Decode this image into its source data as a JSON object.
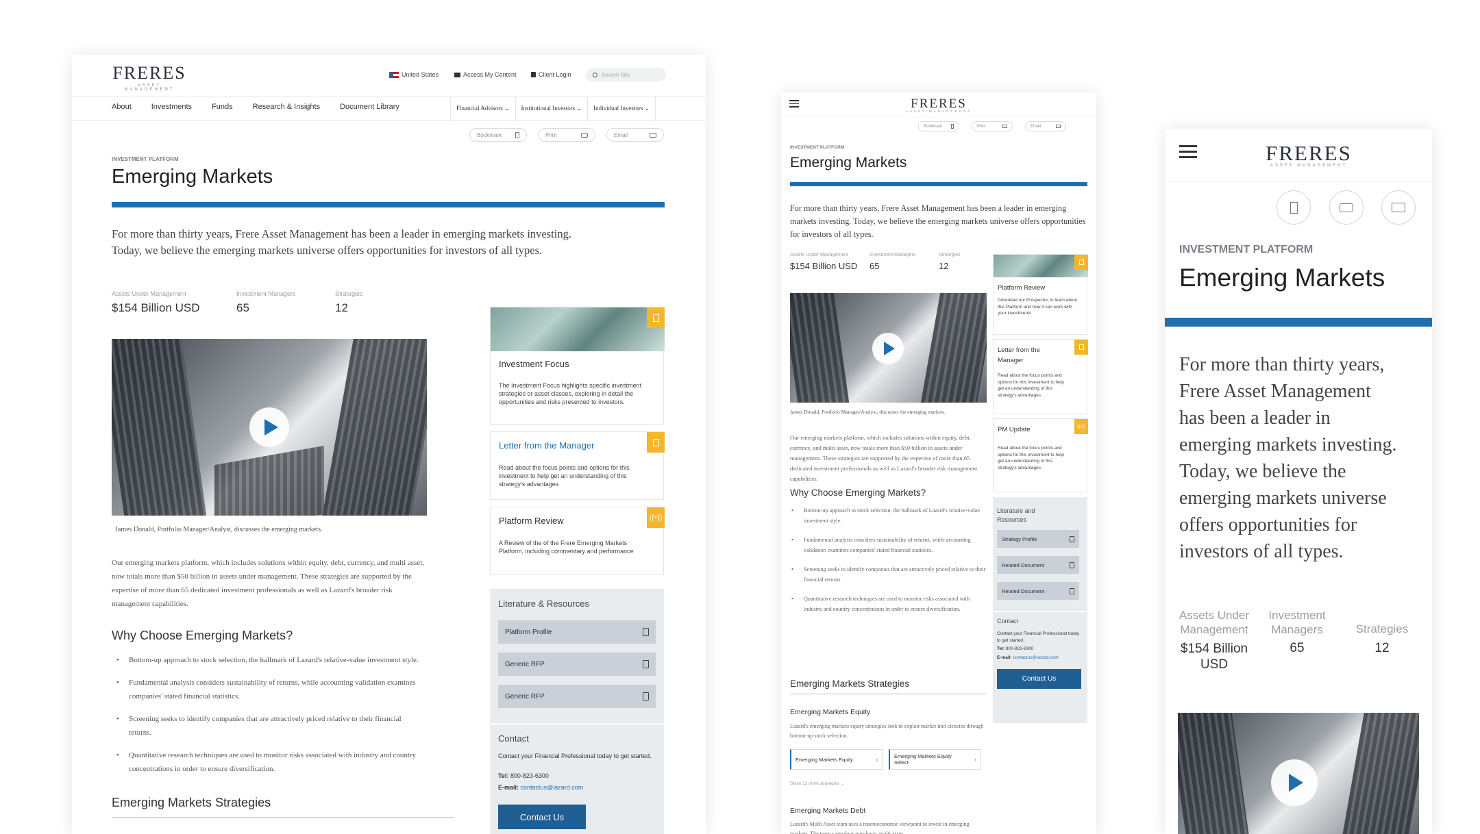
{
  "brand": {
    "name": "FRERES",
    "tagline": "ASSET MANAGEMENT"
  },
  "utility": {
    "country": "United States",
    "access": "Access My Content",
    "login": "Client Login",
    "search_placeholder": "Search Site"
  },
  "nav": {
    "items": [
      "About",
      "Investments",
      "Funds",
      "Research & Insights",
      "Document Library"
    ],
    "audiences": [
      "Financial Advisors",
      "Institutional Investors",
      "Individual Investors"
    ]
  },
  "actions": {
    "bookmark": "Bookmark",
    "print": "Print",
    "email": "Email"
  },
  "page": {
    "kicker": "INVESTMENT PLATFORM",
    "title": "Emerging Markets",
    "intro": "For more than thirty years, Frere Asset Management has been a leader in emerging markets investing. Today, we believe the emerging markets universe offers opportunities for investors of all types."
  },
  "stats": {
    "aum": {
      "label": "Assets Under Management",
      "value": "$154 Billion USD"
    },
    "managers": {
      "label": "Investment Managers",
      "value": "65"
    },
    "strategies": {
      "label": "Strategies",
      "value": "12"
    }
  },
  "mobile_stats": {
    "aum_label_1": "Assets Under",
    "aum_label_2": "Management",
    "aum_value_1": "$154 Billion",
    "aum_value_2": "USD",
    "mgr_label_1": "Investment",
    "mgr_label_2": "Managers"
  },
  "mobile_intro_lines": [
    "For more than thirty years,",
    "Frere Asset Management",
    "has been a leader in",
    "emerging markets investing.",
    "Today, we believe the",
    "emerging markets universe",
    "offers opportunities for",
    "investors of all types."
  ],
  "video_caption": "James Donald, Portfolio Manager/Analyst, discusses the emerging markets.",
  "body_text": "Our emerging markets platform, which includes solutions within equity, debt, currency, and multi asset, now totals more than $50 billion in assets under management. These strategies are supported by the expertise of more than 65 dedicated investment professionals as well as Lazard's broader risk management capabilities.",
  "why": {
    "heading": "Why Choose Emerging Markets?",
    "bullets": [
      "Bottom-up approach to stock selection, the hallmark of Lazard's relative-value investment style.",
      "Fundamental analysis considers sustainability of returns, while accounting validation examines companies' stated financial statistics.",
      "Screening seeks to identify companies that are attractively priced relative to their financial returns.",
      "Quantitative research techniques are used to monitor risks associated with industry and country concentrations in order to ensure diversification."
    ]
  },
  "strategies_heading": "Emerging Markets Strategies",
  "cards": {
    "focus": {
      "title": "Investment Focus",
      "text": "The Investment Focus highlights specific investment strategies or asset classes, exploring in detail the opportunities and risks presented to investors."
    },
    "letter": {
      "title": "Letter from the Manager",
      "text": "Read about the focus points and options for this investment to help get an understanding of this strategy's advantages"
    },
    "review": {
      "title": "Platform Review",
      "text": "A Review of the of the Frere Emerging Markets Platform, including commentary and performance"
    },
    "tablet_review": {
      "title": "Platform Review",
      "text": "Download our Prospectus to learn about this Platform and how it can work with your investments"
    },
    "tablet_letter": {
      "title": "Letter from the Manager",
      "text": "Read about the focus points and options for this investment to help get an understanding of this strategy's advantages"
    },
    "pm_update": {
      "title": "PM Update",
      "text": "Read about the focus points and options for this investment to help get an understanding of this strategy's advantages"
    }
  },
  "literature": {
    "heading": "Literature & Resources",
    "docs": [
      "Platform Profile",
      "Generic RFP",
      "Generic RFP"
    ],
    "tablet_heading": "Literature and Resources",
    "tablet_docs": [
      "Strategy Profile",
      "Related Document",
      "Related Document"
    ]
  },
  "contact": {
    "heading": "Contact",
    "text": "Contact your Financial Professional today to get started.",
    "tel_label": "Tel:",
    "tel": "800-823-6300",
    "email_label": "E-mail:",
    "email": "contactus@lazard.com",
    "button": "Contact Us"
  },
  "tablet_strategies": {
    "equity_title": "Emerging Markets Equity",
    "equity_text": "Lazard's emerging markets equity strategies seek to exploit market inef ciencies through bottom-up stock selection.",
    "chips": [
      "Emerging Markets Equity",
      "Emerging Markets Equity Select"
    ],
    "more": "Show 12 more strategies",
    "debt_title": "Emerging Markets Debt",
    "debt_text": "Lazard's Multi Asset team uses a macroeconomic viewpoint to invest in emerging markets. The team s employs top-down, multi asset"
  },
  "colors": {
    "accent": "#1f6fad",
    "badge": "#f4b62c",
    "button": "#1f5f94"
  }
}
